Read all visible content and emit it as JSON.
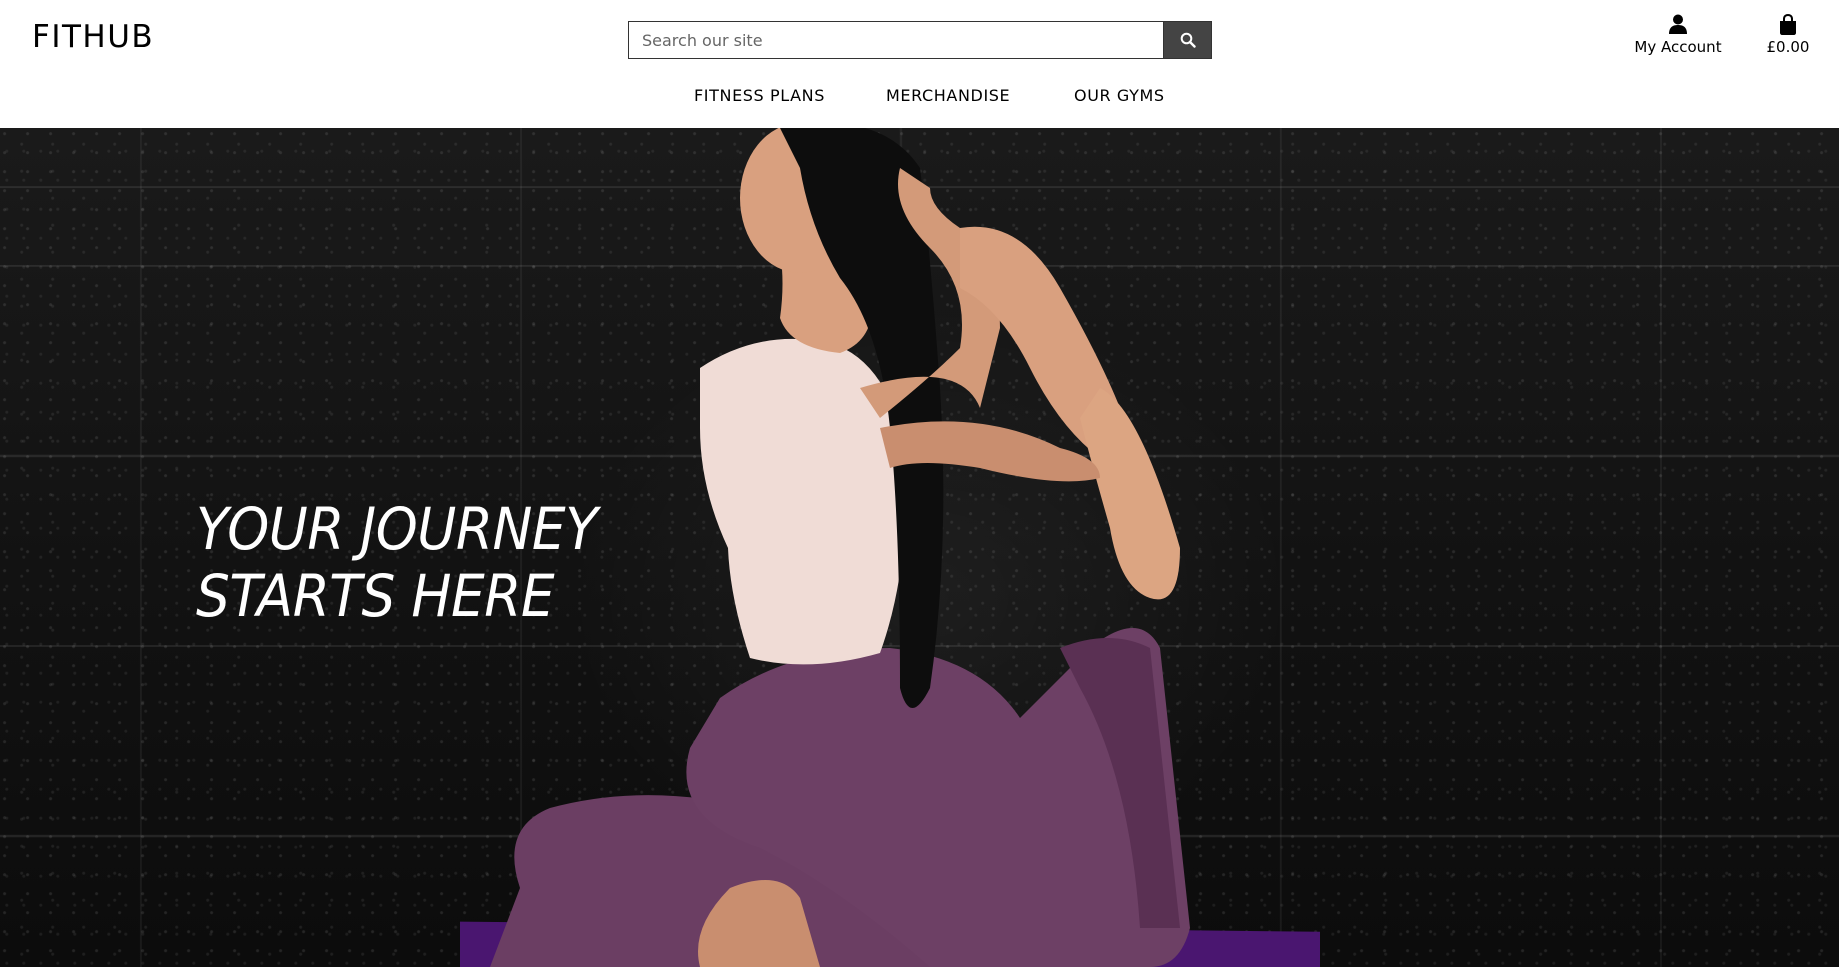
{
  "header": {
    "logo": "FITHUB",
    "search": {
      "placeholder": "Search our site",
      "value": ""
    },
    "account_label": "My Account",
    "bag_total": "£0.00",
    "icons": {
      "search": "search-icon",
      "account": "user-icon",
      "bag": "shopping-bag-icon"
    }
  },
  "nav": {
    "items": [
      {
        "label": "FITNESS PLANS"
      },
      {
        "label": "MERCHANDISE"
      },
      {
        "label": "OUR GYMS"
      }
    ]
  },
  "hero": {
    "line1": "YOUR JOURNEY",
    "line2": "STARTS HERE",
    "image_subject": "woman in yoga pose against dark brick wall",
    "colors": {
      "top": "#f0dcd6",
      "leggings": "#6b3e63",
      "mat": "#4a1670",
      "skin": "#d9a07f",
      "hair": "#0d0d0d"
    }
  }
}
